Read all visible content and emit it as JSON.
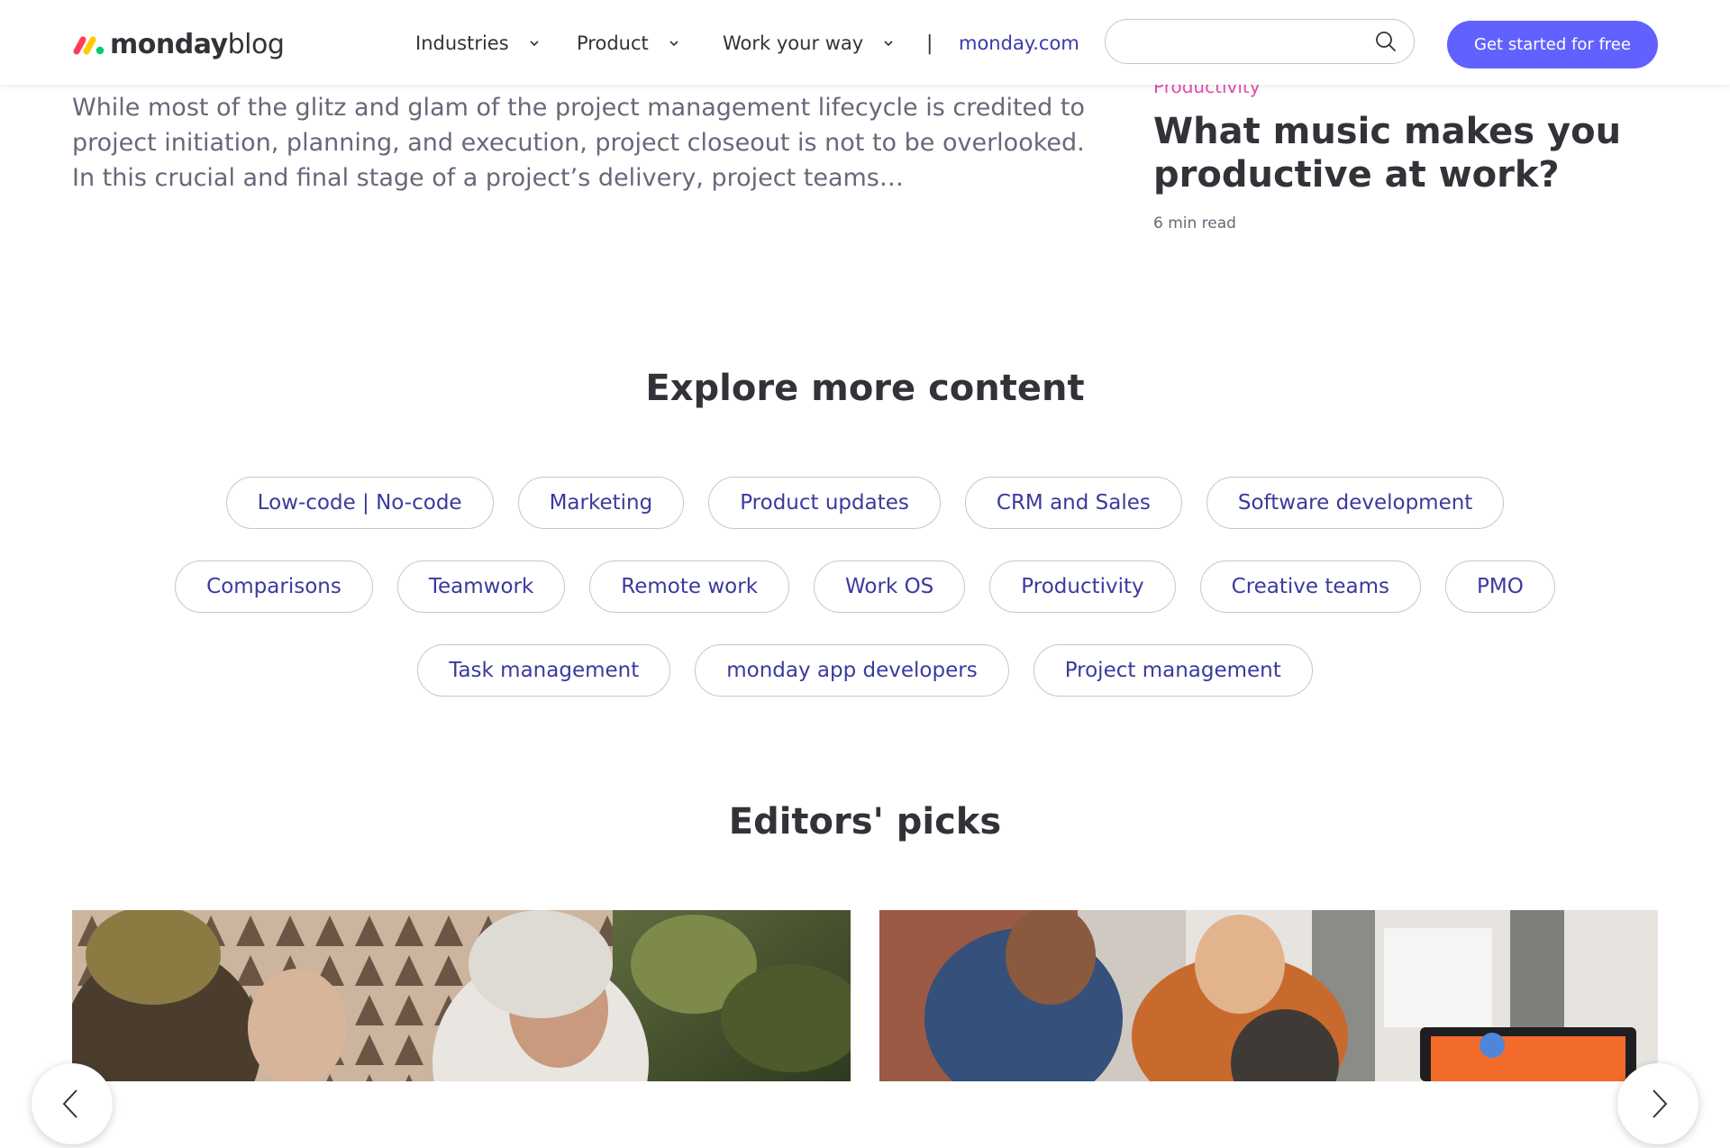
{
  "header": {
    "logo": {
      "brand": "monday",
      "suffix": "blog"
    },
    "nav": [
      {
        "label": "Industries"
      },
      {
        "label": "Product"
      },
      {
        "label": "Work your way"
      }
    ],
    "separator": "|",
    "site_link": "monday.com",
    "search": {
      "value": "",
      "placeholder": ""
    },
    "cta_label": "Get started for free"
  },
  "article": {
    "excerpt": "While most of the glitz and glam of the project management lifecycle is credited to project initiation, planning, and execution, project closeout is not to be overlooked. In this crucial and final stage of a project’s delivery, project teams…"
  },
  "side_card": {
    "tag": "Productivity",
    "title": "What music makes you productive at work?",
    "meta": "6 min read"
  },
  "explore": {
    "title": "Explore more content",
    "rows": [
      [
        "Low-code | No-code",
        "Marketing",
        "Product updates",
        "CRM and Sales",
        "Software development"
      ],
      [
        "Comparisons",
        "Teamwork",
        "Remote work",
        "Work OS",
        "Productivity",
        "Creative teams",
        "PMO"
      ],
      [
        "Task management",
        "monday app developers",
        "Project management"
      ]
    ]
  },
  "editors_picks": {
    "title": "Editors' picks"
  },
  "colors": {
    "accent": "#6161ff",
    "tag_text": "#3a3a9e",
    "category_pink": "#e44cab",
    "body_text": "#323338",
    "muted_text": "#676879"
  },
  "icons": [
    "monday-logo-icon",
    "chevron-down-icon",
    "search-icon",
    "arrow-left-icon",
    "arrow-right-icon"
  ]
}
